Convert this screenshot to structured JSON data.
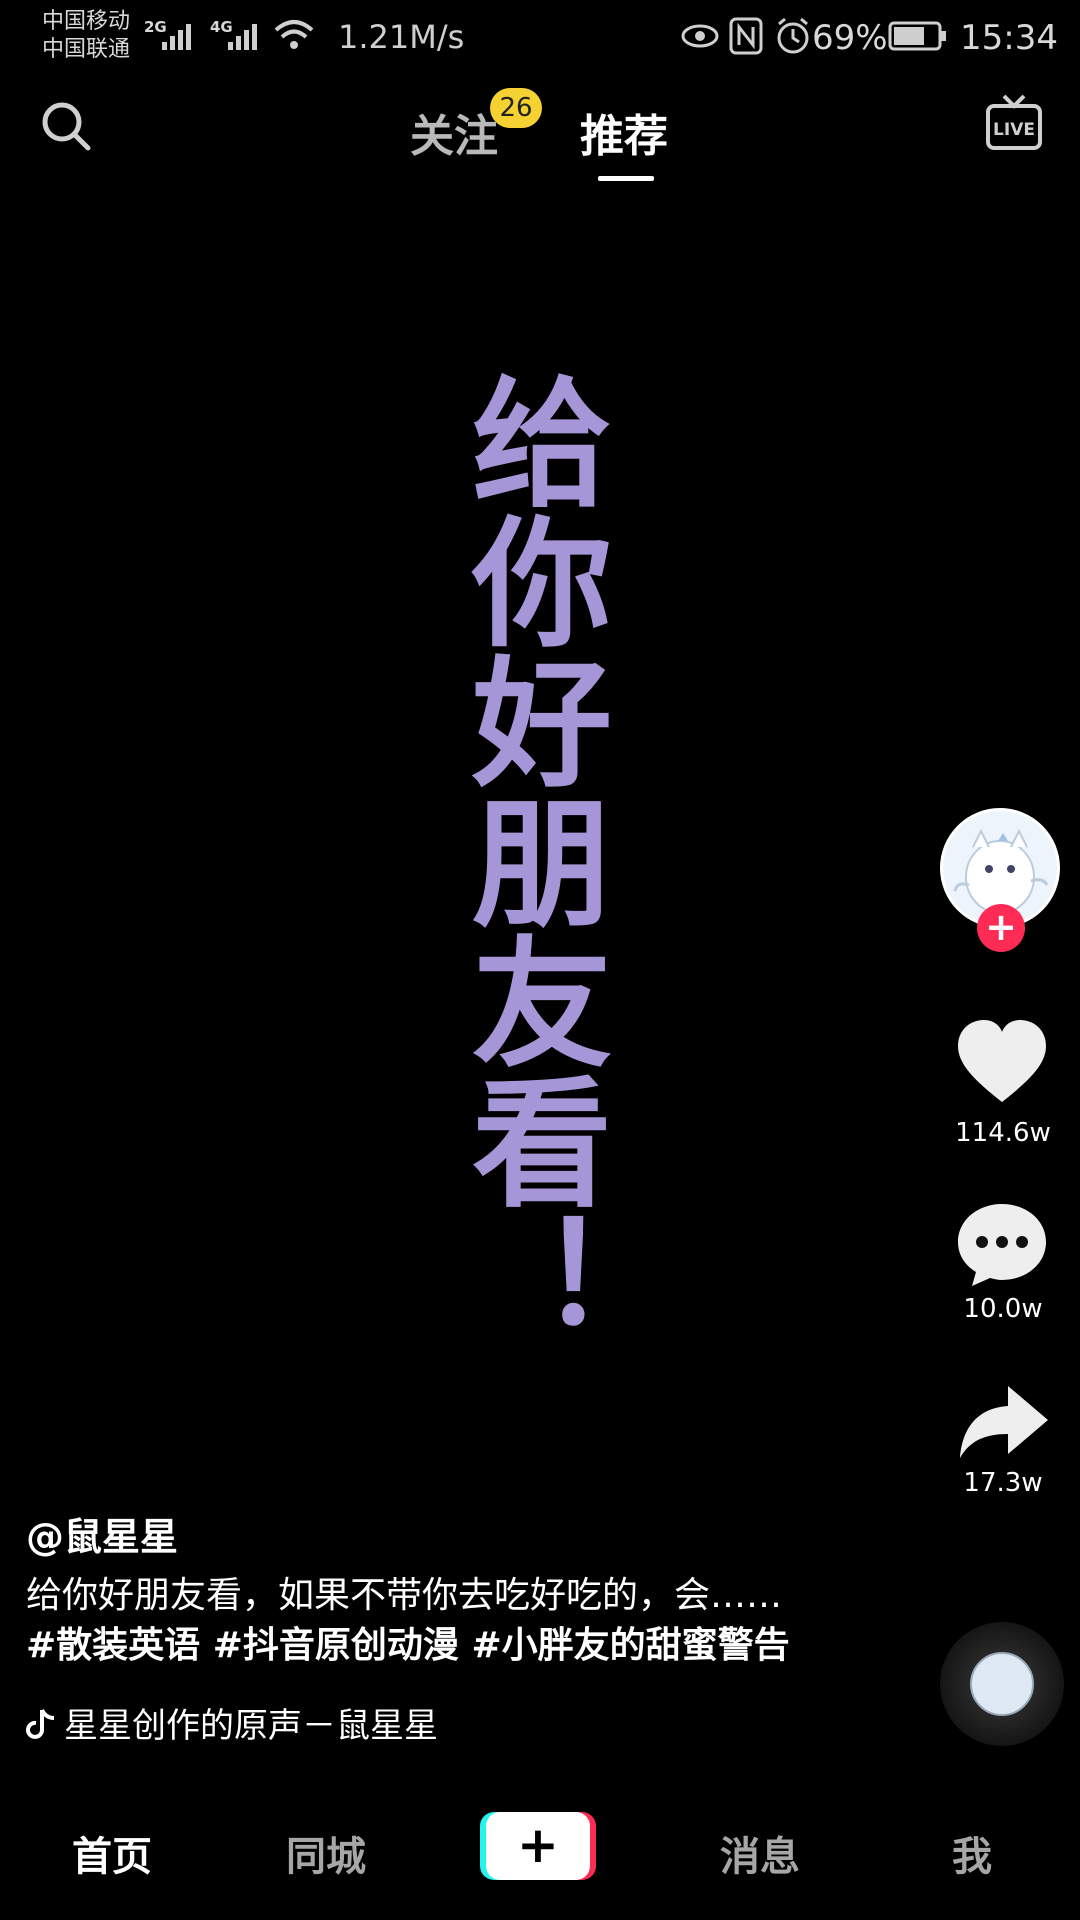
{
  "status_bar": {
    "carrier_1": "中国移动",
    "carrier_2": "中国联通",
    "net_1": "2G",
    "net_2": "4G",
    "speed": "1.21M/s",
    "battery": "69%",
    "time": "15:34"
  },
  "top_nav": {
    "tabs": [
      {
        "label": "关注",
        "badge": "26"
      },
      {
        "label": "推荐",
        "active": true
      }
    ],
    "search_icon": "search-icon",
    "live_icon": "live-icon"
  },
  "video": {
    "overlay_text": "给你好朋友看！"
  },
  "right_rail": {
    "like_count": "114.6w",
    "comment_count": "10.0w",
    "share_count": "17.3w"
  },
  "caption": {
    "author": "@鼠星星",
    "text": "给你好朋友看，如果不带你去吃好吃的，会……",
    "hashtags": [
      "#散装英语",
      "#抖音原创动漫",
      "#小胖友的甜蜜警告"
    ],
    "music": "星星创作的原声－鼠星星"
  },
  "bottom_nav": {
    "items": [
      "首页",
      "同城",
      "消息",
      "我"
    ],
    "create_symbol": "+"
  },
  "colors": {
    "accent_red": "#fe2c55",
    "accent_cyan": "#25f4ee",
    "badge_yellow": "#f5d132",
    "overlay_purple": "#a596d8"
  }
}
